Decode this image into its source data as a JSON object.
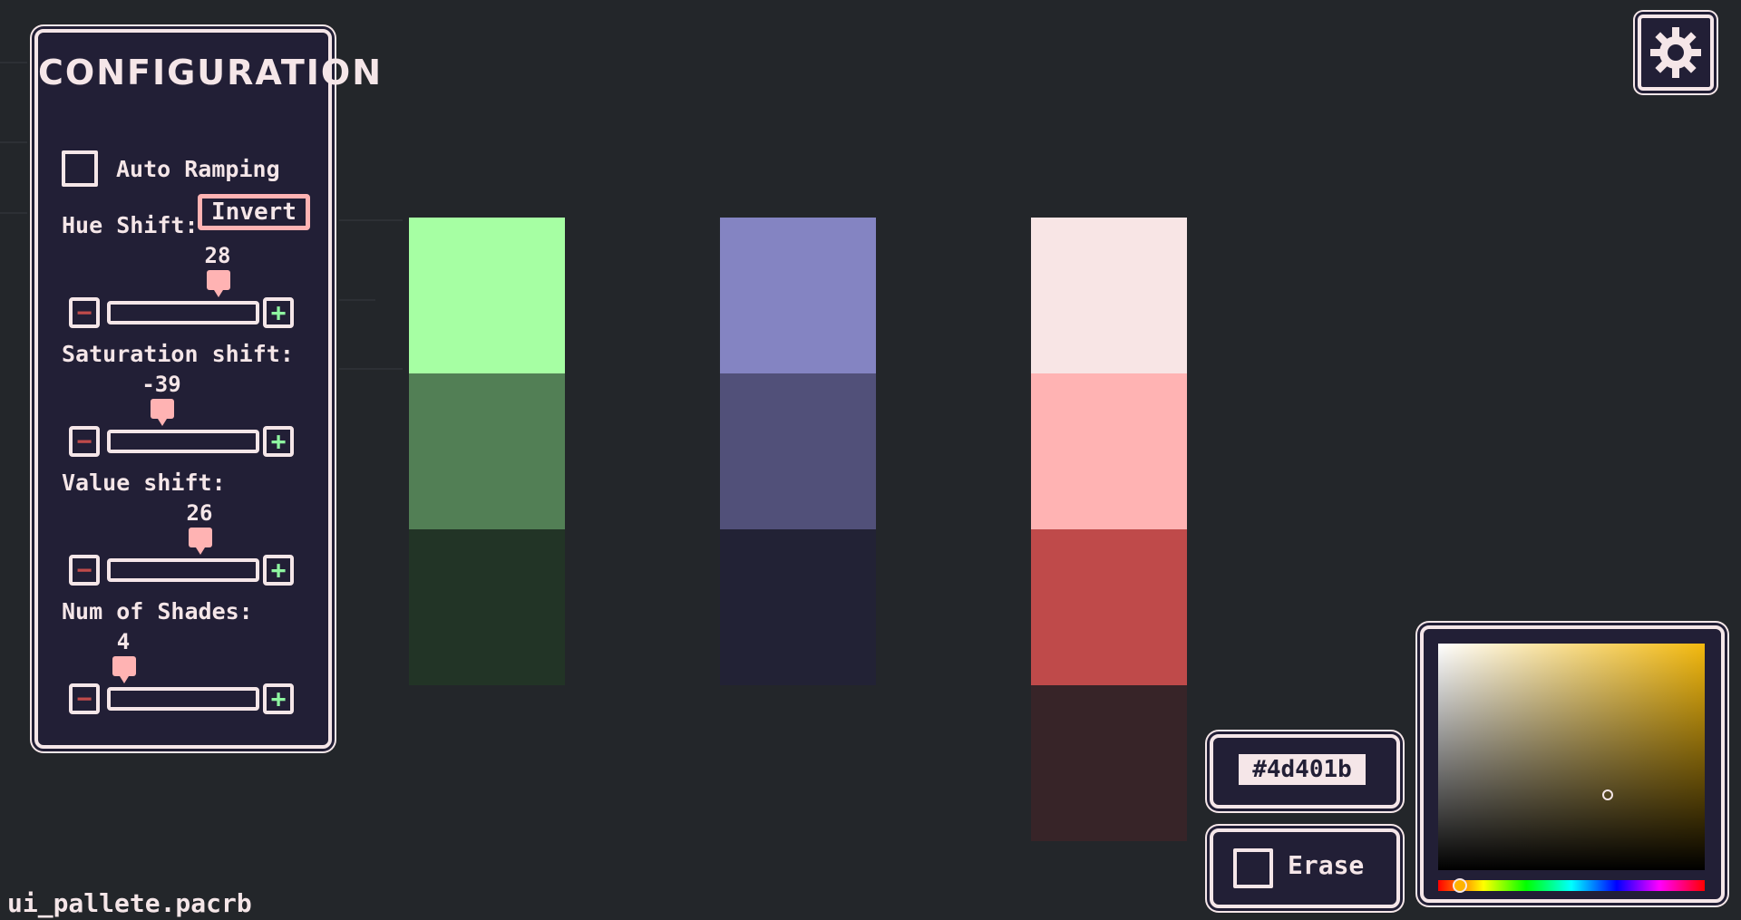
{
  "config": {
    "title": "CONFIGURATION",
    "auto_ramping_label": "Auto Ramping",
    "auto_ramping_checked": false,
    "hue_shift": {
      "label": "Hue Shift:",
      "invert_label": "Invert",
      "value": "28"
    },
    "saturation_shift": {
      "label": "Saturation shift:",
      "value": "-39"
    },
    "value_shift": {
      "label": "Value shift:",
      "value": "26"
    },
    "num_shades": {
      "label": "Num of Shades:",
      "value": "4"
    },
    "minus_symbol": "−",
    "plus_symbol": "+"
  },
  "palettes": [
    {
      "colors": [
        "#a6ffa3",
        "#527f55",
        "#223426"
      ]
    },
    {
      "colors": [
        "#8484c2",
        "#515079",
        "#222235"
      ]
    },
    {
      "colors": [
        "#f8e5e5",
        "#ffb3b3",
        "#bf4a4a",
        "#372428"
      ]
    }
  ],
  "hex_input": {
    "value": "#4d401b"
  },
  "erase": {
    "label": "Erase",
    "checked": false
  },
  "file": {
    "name": "ui_pallete.pacrb"
  },
  "colors": {
    "background": "#23262a",
    "panel": "#221f36",
    "border": "#f5e6e8",
    "accent": "#ffb3b3",
    "minus": "#c04a4a",
    "plus": "#8ef5a0",
    "picker_hue": "#f3b90e"
  },
  "icons": {
    "settings": "gear-icon"
  }
}
